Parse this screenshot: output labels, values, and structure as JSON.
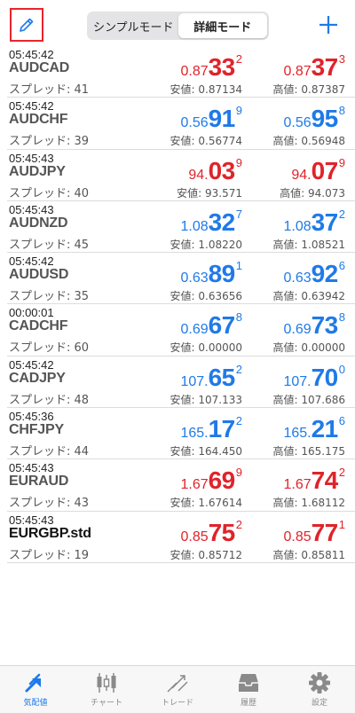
{
  "header": {
    "segments": [
      {
        "label": "シンプルモード",
        "active": false
      },
      {
        "label": "詳細モード",
        "active": true
      }
    ],
    "edit_icon": "pencil-icon",
    "add_icon": "plus-icon"
  },
  "colors": {
    "up": "#e0232a",
    "down": "#1f7ae8",
    "accent": "#1f7ae8"
  },
  "quotes": [
    {
      "time": "05:45:42",
      "symbol": "AUDCAD",
      "spread": "スプレッド: 41",
      "bid": {
        "prefix": "0.87",
        "big": "33",
        "sup": "2",
        "color": "red"
      },
      "ask": {
        "prefix": "0.87",
        "big": "37",
        "sup": "3",
        "color": "red"
      },
      "low": "安値: 0.87134",
      "high": "高値: 0.87387"
    },
    {
      "time": "05:45:42",
      "symbol": "AUDCHF",
      "spread": "スプレッド: 39",
      "bid": {
        "prefix": "0.56",
        "big": "91",
        "sup": "9",
        "color": "blue"
      },
      "ask": {
        "prefix": "0.56",
        "big": "95",
        "sup": "8",
        "color": "blue"
      },
      "low": "安値: 0.56774",
      "high": "高値: 0.56948"
    },
    {
      "time": "05:45:43",
      "symbol": "AUDJPY",
      "spread": "スプレッド: 40",
      "bid": {
        "prefix": "94.",
        "big": "03",
        "sup": "9",
        "color": "red"
      },
      "ask": {
        "prefix": "94.",
        "big": "07",
        "sup": "9",
        "color": "red"
      },
      "low": "安値: 93.571",
      "high": "高値: 94.073"
    },
    {
      "time": "05:45:43",
      "symbol": "AUDNZD",
      "spread": "スプレッド: 45",
      "bid": {
        "prefix": "1.08",
        "big": "32",
        "sup": "7",
        "color": "blue"
      },
      "ask": {
        "prefix": "1.08",
        "big": "37",
        "sup": "2",
        "color": "blue"
      },
      "low": "安値: 1.08220",
      "high": "高値: 1.08521"
    },
    {
      "time": "05:45:42",
      "symbol": "AUDUSD",
      "spread": "スプレッド: 35",
      "bid": {
        "prefix": "0.63",
        "big": "89",
        "sup": "1",
        "color": "blue"
      },
      "ask": {
        "prefix": "0.63",
        "big": "92",
        "sup": "6",
        "color": "blue"
      },
      "low": "安値: 0.63656",
      "high": "高値: 0.63942"
    },
    {
      "time": "00:00:01",
      "symbol": "CADCHF",
      "spread": "スプレッド: 60",
      "bid": {
        "prefix": "0.69",
        "big": "67",
        "sup": "8",
        "color": "blue"
      },
      "ask": {
        "prefix": "0.69",
        "big": "73",
        "sup": "8",
        "color": "blue"
      },
      "low": "安値: 0.00000",
      "high": "高値: 0.00000"
    },
    {
      "time": "05:45:42",
      "symbol": "CADJPY",
      "spread": "スプレッド: 48",
      "bid": {
        "prefix": "107.",
        "big": "65",
        "sup": "2",
        "color": "blue"
      },
      "ask": {
        "prefix": "107.",
        "big": "70",
        "sup": "0",
        "color": "blue"
      },
      "low": "安値: 107.133",
      "high": "高値: 107.686"
    },
    {
      "time": "05:45:36",
      "symbol": "CHFJPY",
      "spread": "スプレッド: 44",
      "bid": {
        "prefix": "165.",
        "big": "17",
        "sup": "2",
        "color": "blue"
      },
      "ask": {
        "prefix": "165.",
        "big": "21",
        "sup": "6",
        "color": "blue"
      },
      "low": "安値: 164.450",
      "high": "高値: 165.175"
    },
    {
      "time": "05:45:43",
      "symbol": "EURAUD",
      "spread": "スプレッド: 43",
      "bid": {
        "prefix": "1.67",
        "big": "69",
        "sup": "9",
        "color": "red"
      },
      "ask": {
        "prefix": "1.67",
        "big": "74",
        "sup": "2",
        "color": "red"
      },
      "low": "安値: 1.67614",
      "high": "高値: 1.68112"
    },
    {
      "time": "05:45:43",
      "symbol": "EURGBP.std",
      "spread": "スプレッド: 19",
      "bid": {
        "prefix": "0.85",
        "big": "75",
        "sup": "2",
        "color": "red"
      },
      "ask": {
        "prefix": "0.85",
        "big": "77",
        "sup": "1",
        "color": "red"
      },
      "low": "安値: 0.85712",
      "high": "高値: 0.85811"
    }
  ],
  "tabs": [
    {
      "label": "気配値",
      "icon": "quotes-icon",
      "active": true
    },
    {
      "label": "チャート",
      "icon": "candlestick-chart-icon",
      "active": false
    },
    {
      "label": "トレード",
      "icon": "trade-icon",
      "active": false
    },
    {
      "label": "履歴",
      "icon": "history-inbox-icon",
      "active": false
    },
    {
      "label": "設定",
      "icon": "gear-icon",
      "active": false
    }
  ]
}
